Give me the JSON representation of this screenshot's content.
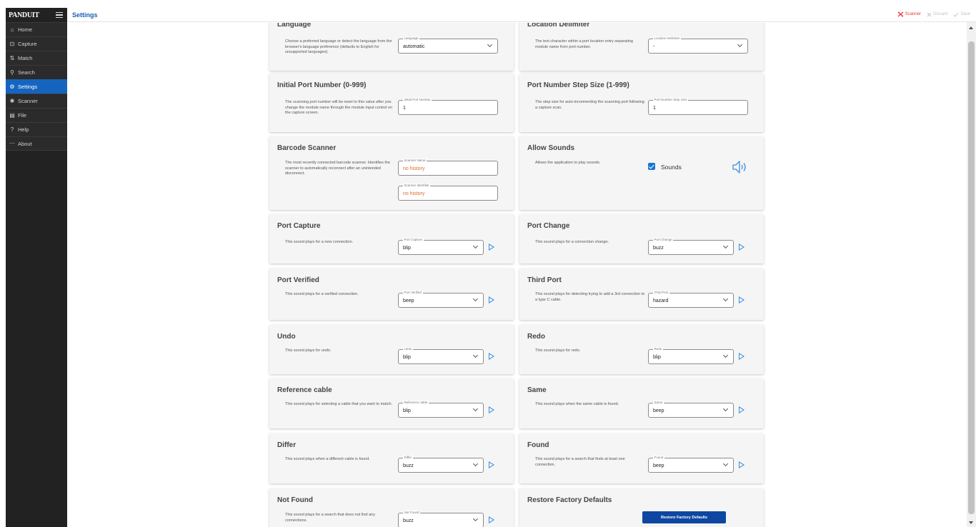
{
  "app": {
    "logo": "PANDUIT",
    "page_title": "Settings"
  },
  "sidebar": {
    "items": [
      {
        "label": "Home",
        "icon": "home-icon",
        "glyph": "⌂",
        "active": false
      },
      {
        "label": "Capture",
        "icon": "capture-icon",
        "glyph": "⊡",
        "active": false
      },
      {
        "label": "Match",
        "icon": "match-icon",
        "glyph": "⇅",
        "active": false
      },
      {
        "label": "Search",
        "icon": "search-icon",
        "glyph": "⚲",
        "active": false
      },
      {
        "label": "Settings",
        "icon": "gear-icon",
        "glyph": "⚙",
        "active": true
      },
      {
        "label": "Scanner",
        "icon": "bluetooth-icon",
        "glyph": "✱",
        "active": false
      },
      {
        "label": "File",
        "icon": "file-icon",
        "glyph": "▤",
        "active": false
      },
      {
        "label": "Help",
        "icon": "help-icon",
        "glyph": "?",
        "active": false
      },
      {
        "label": "About",
        "icon": "more-icon",
        "glyph": "⋯",
        "active": false
      }
    ]
  },
  "header": {
    "actions": [
      {
        "label": "Scanner",
        "icon": "scanner-disconnected-icon",
        "state": "error"
      },
      {
        "label": "Discard",
        "icon": "close-icon",
        "state": "disabled"
      },
      {
        "label": "Save",
        "icon": "check-icon",
        "state": "disabled"
      }
    ]
  },
  "cards": {
    "language": {
      "title": "Language",
      "desc": "Choose a preferred language or detect the language from the browser's language preference (defaults to English for unsupported languages).",
      "field_label": "Language",
      "value": "automatic"
    },
    "location_delimiter": {
      "title": "Location Delimiter",
      "desc": "The text character within a port location entry separating module name from port number.",
      "field_label": "Location Delimiter",
      "value": "-"
    },
    "initial_port": {
      "title": "Initial Port Number (0-999)",
      "desc": "The scanning port number will be reset to this value after you change the module name through the module input control on the capture screen.",
      "field_label": "Initial Port Number",
      "value": "1"
    },
    "port_step": {
      "title": "Port Number Step Size (1-999)",
      "desc": "The step size for auto-incrementing the scanning port following a capture scan.",
      "field_label": "Port Number Step Size",
      "value": "1"
    },
    "barcode_scanner": {
      "title": "Barcode Scanner",
      "desc": "The most recently connected barcode scanner. Identifies the scanner to automatically reconnect after an unintended disconnect.",
      "name_label": "Scanner Name",
      "name_value": "no history",
      "id_label": "Scanner Identifier",
      "id_value": "no history"
    },
    "allow_sounds": {
      "title": "Allow Sounds",
      "desc": "Allows the application to play sounds.",
      "checkbox_label": "Sounds",
      "checked": true
    },
    "port_capture": {
      "title": "Port Capture",
      "desc": "This sound plays for a new connection.",
      "field_label": "Port Capture",
      "value": "blip"
    },
    "port_change": {
      "title": "Port Change",
      "desc": "This sound plays for a connection change.",
      "field_label": "Port Change",
      "value": "buzz"
    },
    "port_verified": {
      "title": "Port Verified",
      "desc": "This sound plays for a verified connection.",
      "field_label": "Port Verified",
      "value": "beep"
    },
    "third_port": {
      "title": "Third Port",
      "desc": "This sound plays for detecting trying to add a 3rd connection to a type C cable.",
      "field_label": "Third Port",
      "value": "hazard"
    },
    "undo": {
      "title": "Undo",
      "desc": "This sound plays for undo.",
      "field_label": "Undo",
      "value": "blip"
    },
    "redo": {
      "title": "Redo",
      "desc": "This sound plays for redo.",
      "field_label": "Redo",
      "value": "blip"
    },
    "reference_cable": {
      "title": "Reference cable",
      "desc": "This sound plays for selecting a cable that you want to match.",
      "field_label": "Reference cable",
      "value": "blip"
    },
    "same": {
      "title": "Same",
      "desc": "This sound plays when the same cable is found.",
      "field_label": "Same",
      "value": "beep"
    },
    "differ": {
      "title": "Differ",
      "desc": "This sound plays when a different cable is found.",
      "field_label": "Differ",
      "value": "buzz"
    },
    "found": {
      "title": "Found",
      "desc": "This sound plays for a search that finds at least one connection.",
      "field_label": "Found",
      "value": "beep"
    },
    "not_found": {
      "title": "Not Found",
      "desc": "This sound plays for a search that does not find any connections.",
      "field_label": "Not Found",
      "value": "buzz"
    },
    "restore": {
      "title": "Restore Factory Defaults",
      "button_label": "Restore Factory Defaults"
    }
  },
  "colors": {
    "accent": "#1565c0",
    "title_blue": "#1a5fb4",
    "error": "#e53935",
    "play": "#3d8fe0",
    "no_history": "#e06c2c"
  }
}
